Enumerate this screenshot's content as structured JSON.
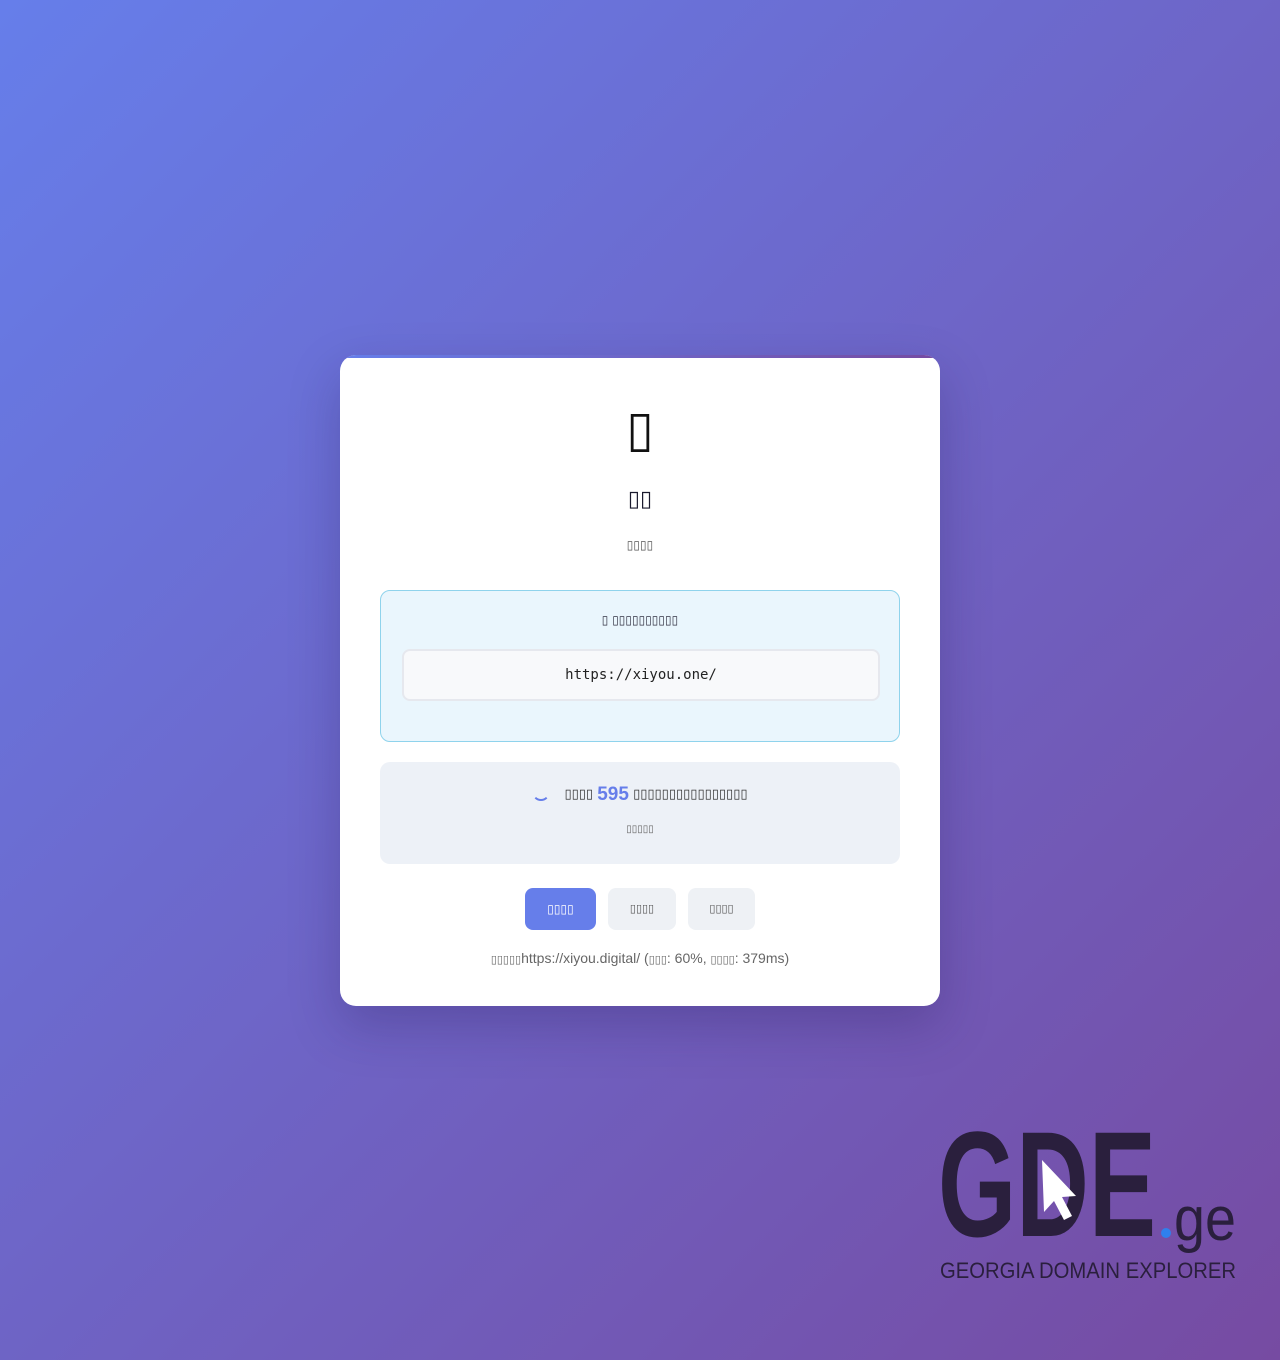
{
  "hero": {
    "icon_name": "unrendered-glyph-icon",
    "icon_glyph": "▯",
    "title": "▯▯",
    "subtitle": "▯▯▯▯"
  },
  "target": {
    "label_prefix": "▯",
    "label": "▯▯▯▯▯▯▯▯▯▯",
    "url": "https://xiyou.one/"
  },
  "status": {
    "prefix": "▯▯▯▯",
    "count": "595",
    "suffix": "▯▯▯▯▯▯▯▯▯▯▯▯▯▯▯▯",
    "sub": "▯▯▯▯▯"
  },
  "buttons": {
    "primary": "▯▯▯▯",
    "secondary": "▯▯▯▯",
    "tertiary": "▯▯▯▯"
  },
  "footer": {
    "prefix": "▯▯▯▯▯",
    "url": "https://xiyou.digital/",
    "open": " (",
    "metric1_label": "▯▯▯",
    "metric1_value": ": 60%, ",
    "metric2_label": "▯▯▯▯",
    "metric2_value": ": 379ms)"
  },
  "logo": {
    "mark": "GDE",
    "tld": "ge",
    "tagline": "GEORGIA DOMAIN EXPLORER"
  },
  "colors": {
    "gradient_start": "#667eea",
    "gradient_end": "#764ba2",
    "accent": "#667eea",
    "logo_dark": "#2a1f3d",
    "logo_dot": "#2f80ed"
  }
}
